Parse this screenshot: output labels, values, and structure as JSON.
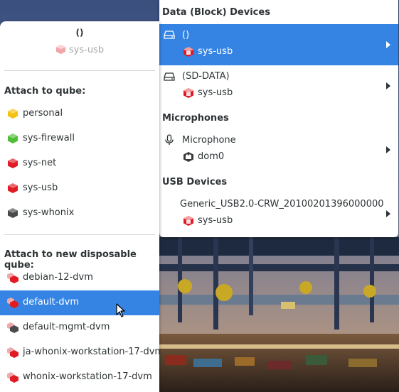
{
  "devices_panel": {
    "data_header": "Data (Block) Devices",
    "data_devices": [
      {
        "name": "()",
        "vm": "sys-usb",
        "selected": true,
        "icon": "drive-icon",
        "vm_color": "#cc0000"
      },
      {
        "name": "(SD-DATA)",
        "vm": "sys-usb",
        "selected": false,
        "icon": "drive-icon",
        "vm_color": "#cc0000"
      }
    ],
    "mic_header": "Microphones",
    "microphones": [
      {
        "name": "Microphone",
        "vm": "dom0",
        "icon": "microphone-icon"
      }
    ],
    "usb_header": "USB Devices",
    "usb_devices": [
      {
        "name": "Generic_USB2.0-CRW_20100201396000000",
        "vm": "sys-usb",
        "vm_color": "#cc0000"
      }
    ]
  },
  "attach_panel": {
    "device_title": "()",
    "device_owner": "sys-usb",
    "attach_header": "Attach to qube:",
    "qubes": [
      {
        "name": "personal",
        "color": "#f5c211",
        "dvm": false
      },
      {
        "name": "sys-firewall",
        "color": "#4fbd35",
        "dvm": false
      },
      {
        "name": "sys-net",
        "color": "#e01b24",
        "dvm": false
      },
      {
        "name": "sys-usb",
        "color": "#e01b24",
        "dvm": false
      },
      {
        "name": "sys-whonix",
        "color": "#4a4a4a",
        "dvm": false
      }
    ],
    "disposable_header": "Attach to new disposable qube:",
    "disposables": [
      {
        "name": "debian-12-dvm",
        "color": "#e01b24",
        "selected": false
      },
      {
        "name": "default-dvm",
        "color": "#e01b24",
        "selected": true
      },
      {
        "name": "default-mgmt-dvm",
        "color": "#4a4a4a",
        "selected": false
      },
      {
        "name": "ja-whonix-workstation-17-dvm",
        "color": "#e01b24",
        "selected": false
      },
      {
        "name": "whonix-workstation-17-dvm",
        "color": "#e01b24",
        "selected": false
      }
    ]
  }
}
